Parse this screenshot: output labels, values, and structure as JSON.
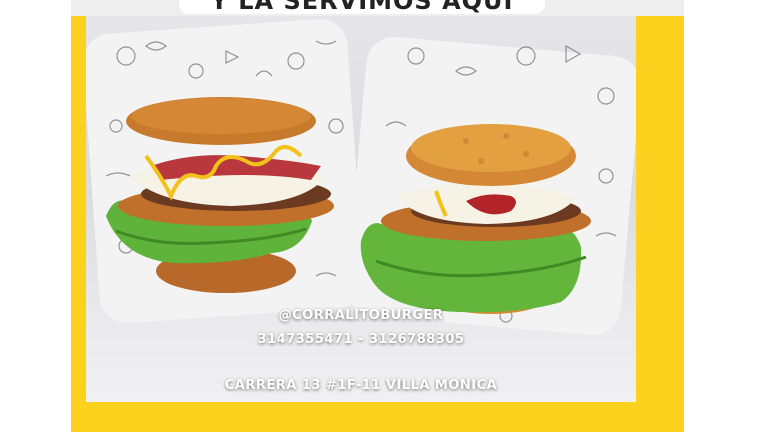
{
  "banner": {
    "text": "Y LA SERVIMOS AQUÍ"
  },
  "overlay": {
    "handle": "@CORRALITOBURGER",
    "phones": "3147355471 - 3126788305",
    "address": "CARRERA 13 #1F-11 VILLA MONICA"
  },
  "colors": {
    "frame": "#fdd21f",
    "patty_bun": "#c87a2c",
    "lettuce": "#5fb23a",
    "cheese": "#f6f3e6",
    "sauce": "#b3242a",
    "mustard": "#f2c21a"
  }
}
